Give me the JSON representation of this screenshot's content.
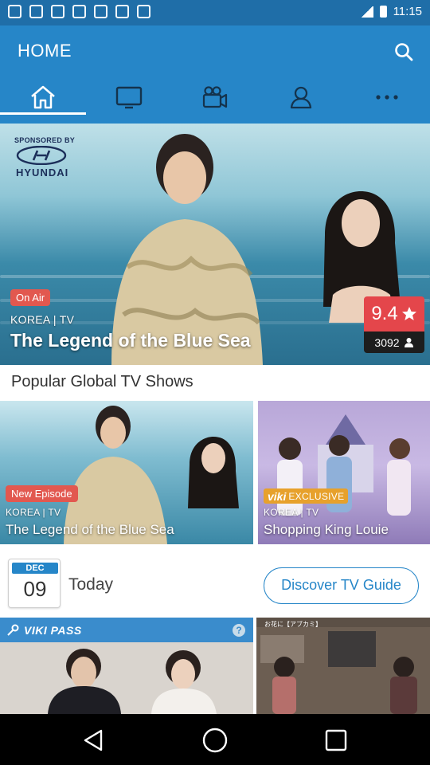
{
  "status_bar": {
    "time": "11:15"
  },
  "header": {
    "title": "HOME"
  },
  "tabs": [
    {
      "name": "home",
      "icon": "home-icon"
    },
    {
      "name": "tv",
      "icon": "tv-icon"
    },
    {
      "name": "movies",
      "icon": "video-camera-icon"
    },
    {
      "name": "profile",
      "icon": "person-icon"
    },
    {
      "name": "more",
      "icon": "more-icon"
    }
  ],
  "hero": {
    "sponsor_label": "SPONSORED BY",
    "sponsor_name": "HYUNDAI",
    "badge": "On Air",
    "meta": "KOREA | TV",
    "title": "The Legend of the Blue Sea",
    "rating": "9.4",
    "votes": "3092"
  },
  "popular": {
    "section_title": "Popular Global TV Shows",
    "cards": [
      {
        "badge": "New Episode",
        "meta": "KOREA | TV",
        "title": "The Legend of the Blue Sea"
      },
      {
        "badge_brand": "viki",
        "badge": "EXCLUSIVE",
        "meta": "KOREA | TV",
        "title": "Shopping King Louie"
      }
    ]
  },
  "today": {
    "month": "DEC",
    "day": "09",
    "label": "Today",
    "guide_button": "Discover TV Guide"
  },
  "bottom": {
    "pass_label": "VIKI PASS",
    "thumb2_caption": "お花に【アブカミ】"
  },
  "colors": {
    "primary": "#2686c8",
    "status": "#1f6ea8",
    "badge_red": "#e2584f",
    "rating_red": "#e4464b",
    "viki_orange": "#e7a12c"
  }
}
